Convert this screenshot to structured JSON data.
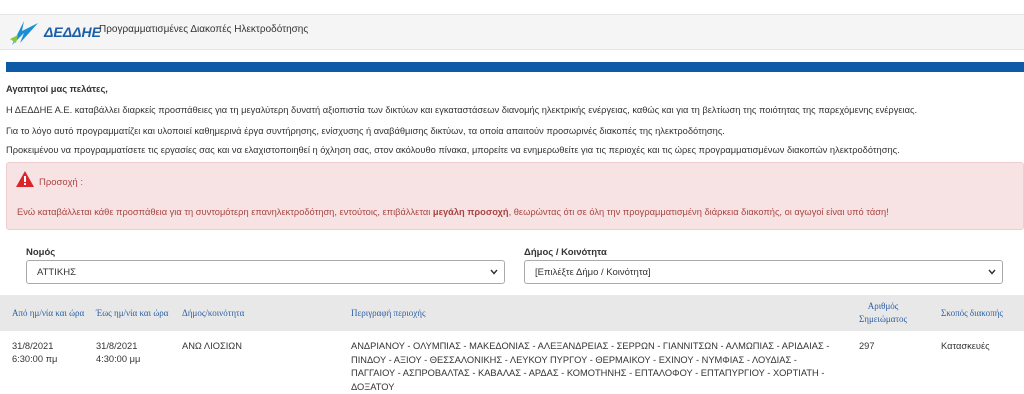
{
  "header": {
    "logo_text": "ΔΕΔΔΗΕ",
    "title": "Προγραμματισμένες Διακοπές Ηλεκτροδότησης"
  },
  "intro": {
    "greeting": "Αγαπητοί μας πελάτες,",
    "p1": "Η ΔΕΔΔΗΕ Α.Ε. καταβάλλει διαρκείς προσπάθειες για τη μεγαλύτερη δυνατή αξιοπιστία των δικτύων και εγκαταστάσεων διανομής ηλεκτρικής ενέργειας, καθώς και για τη βελτίωση της ποιότητας της παρεχόμενης ενέργειας.",
    "p2": "Για το λόγο αυτό προγραμματίζει και υλοποιεί καθημερινά έργα συντήρησης, ενίσχυσης ή αναβάθμισης δικτύων, τα οποία απαιτούν προσωρινές διακοπές της ηλεκτροδότησης.",
    "p3": "Προκειμένου να προγραμματίσετε τις εργασίες σας και να ελαχιστοποιηθεί η όχληση σας, στον ακόλουθο πίνακα, μπορείτε να ενημερωθείτε για τις περιοχές και τις ώρες προγραμματισμένων διακοπών ηλεκτροδότησης."
  },
  "alert": {
    "title": "Προσοχή :",
    "body_before": "Ενώ καταβάλλεται κάθε προσπάθεια για τη συντομότερη επανηλεκτροδότηση, εντούτοις, επιβάλλεται ",
    "body_bold": "μεγάλη προσοχή",
    "body_after": ", θεωρώντας ότι σε όλη την προγραμματισμένη διάρκεια διακοπής, οι αγωγοί είναι υπό τάση!"
  },
  "filters": {
    "nomos_label": "Νομός",
    "nomos_value": "ΑΤΤΙΚΗΣ",
    "dimos_label": "Δήμος / Κοινότητα",
    "dimos_value": "[Επιλέξτε Δήμο / Κοινότητα]"
  },
  "table": {
    "headers": {
      "from": "Από ημ/νία και ώρα",
      "to": "Έως ημ/νία και ώρα",
      "municipality": "Δήμος/κοινότητα",
      "region": "Περιγραφή περιοχής",
      "notes_1": "Αριθμός",
      "notes_2": "Σημειώματος",
      "purpose": "Σκοπός διακοπής"
    },
    "rows": [
      {
        "from_date": "31/8/2021",
        "from_time": "6:30:00 πμ",
        "to_date": "31/8/2021",
        "to_time": "4:30:00 μμ",
        "municipality": "ΑΝΩ ΛΙΟΣΙΩΝ",
        "region": "ΑΝΔΡΙΑΝΟΥ - ΟΛΥΜΠΙΑΣ - ΜΑΚΕΔΟΝΙΑΣ - ΑΛΕΞΑΝΔΡΕΙΑΣ - ΣΕΡΡΩΝ - ΓΙΑΝΝΙΤΣΩΝ - ΑΛΜΩΠΙΑΣ - ΑΡΙΔΑΙΑΣ - ΠΙΝΔΟΥ - ΑΞΙΟΥ - ΘΕΣΣΑΛΟΝΙΚΗΣ - ΛΕΥΚΟΥ ΠΥΡΓΟΥ - ΘΕΡΜΑΙΚΟΥ - ΕΧΙΝΟΥ - ΝΥΜΦΙΑΣ - ΛΟΥΔΙΑΣ - ΠΑΓΓΑΙΟΥ - ΑΣΠΡΟΒΑΛΤΑΣ - ΚΑΒΑΛΑΣ - ΑΡΔΑΣ - ΚΟΜΟΤΗΝΗΣ - ΕΠΤΑΛΟΦΟΥ - ΕΠΤΑΠΥΡΓΙΟΥ - ΧΟΡΤΙΑΤΗ - ΔΟΞΑΤΟΥ",
        "notes": "297",
        "purpose": "Κατασκευές"
      }
    ]
  },
  "colors": {
    "brand_blue": "#0e5aa7",
    "alert_bg": "#f7e3e4",
    "alert_text": "#a94442",
    "header_link": "#2a5fa3"
  }
}
